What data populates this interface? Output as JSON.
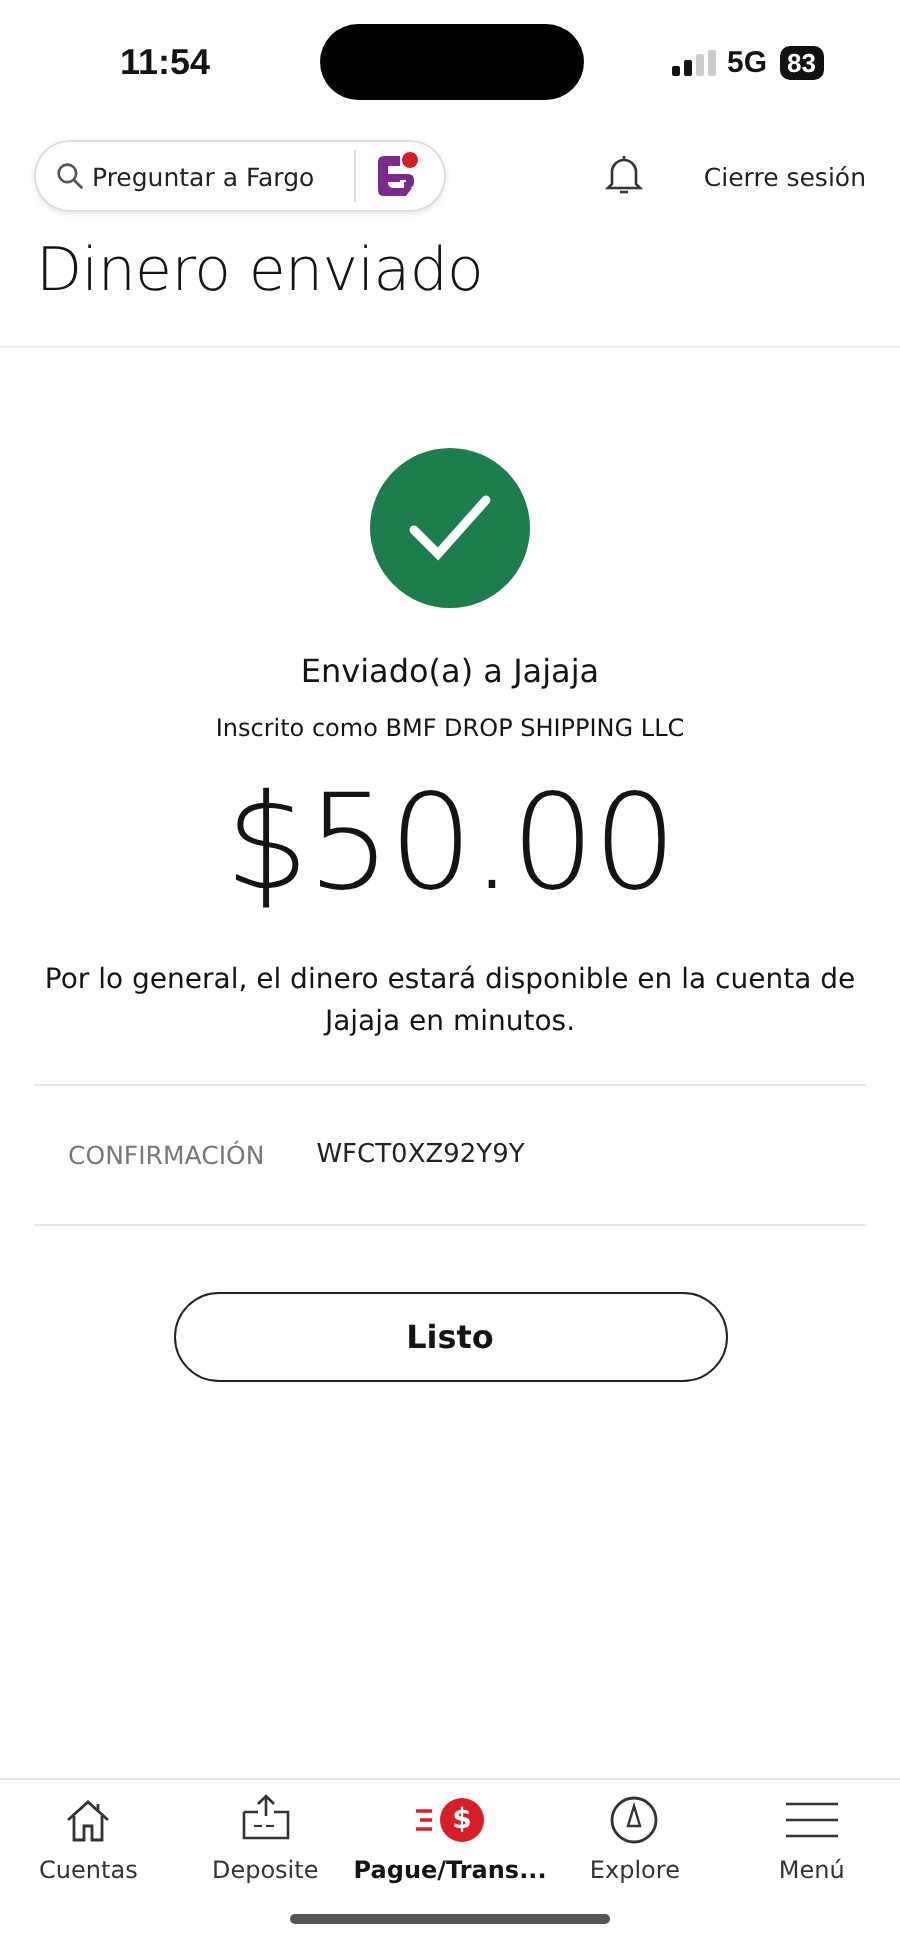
{
  "status_bar": {
    "time": "11:54",
    "network": "5G",
    "battery": "83"
  },
  "header": {
    "search": {
      "placeholder": "Preguntar a Fargo"
    },
    "logout": "Cierre sesión"
  },
  "title": "Dinero enviado",
  "receipt": {
    "recipient": "Enviado(a) a Jajaja",
    "enrolled_as": "Inscrito como BMF DROP SHIPPING LLC",
    "amount": "$50.00",
    "note": "Por lo general, el dinero estará disponible en la cuenta de Jajaja en minutos.",
    "confirmation": {
      "label": "CONFIRMACIÓN",
      "value": "WFCT0XZ92Y9Y"
    },
    "button": "Listo"
  },
  "nav": [
    {
      "label": "Cuentas",
      "selected": false
    },
    {
      "label": "Deposite",
      "selected": false
    },
    {
      "label": "Pague/Trans...",
      "selected": true,
      "badge": "$"
    },
    {
      "label": "Explore",
      "selected": false
    },
    {
      "label": "Menú",
      "selected": false
    }
  ]
}
